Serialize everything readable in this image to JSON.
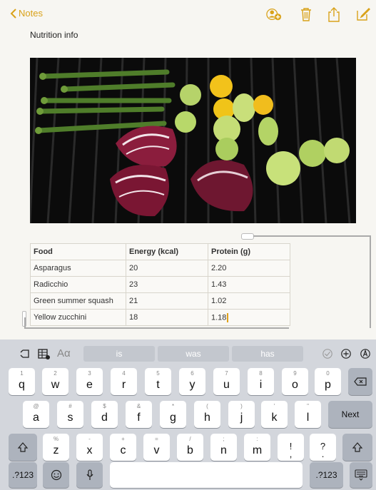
{
  "nav": {
    "back_label": "Notes"
  },
  "note": {
    "title": "Nutrition info"
  },
  "colors": {
    "accent": "#d9a21a",
    "keyboard_bg": "#d3d6dc"
  },
  "table": {
    "headers": [
      "Food",
      "Energy (kcal)",
      "Protein (g)"
    ],
    "rows": [
      [
        "Asparagus",
        "20",
        "2.20"
      ],
      [
        "Radicchio",
        "23",
        "1.43"
      ],
      [
        "Green summer squash",
        "21",
        "1.02"
      ],
      [
        "Yellow zucchini",
        "18",
        "1.18"
      ]
    ]
  },
  "suggestions": [
    "is",
    "was",
    "has"
  ],
  "keyboard": {
    "row1": [
      [
        "1",
        "q"
      ],
      [
        "2",
        "w"
      ],
      [
        "3",
        "e"
      ],
      [
        "4",
        "r"
      ],
      [
        "5",
        "t"
      ],
      [
        "6",
        "y"
      ],
      [
        "7",
        "u"
      ],
      [
        "8",
        "i"
      ],
      [
        "9",
        "o"
      ],
      [
        "0",
        "p"
      ]
    ],
    "row2": [
      [
        "@",
        "a"
      ],
      [
        "#",
        "s"
      ],
      [
        "$",
        "d"
      ],
      [
        "&",
        "f"
      ],
      [
        "*",
        "g"
      ],
      [
        "(",
        "h"
      ],
      [
        ")",
        "j"
      ],
      [
        "'",
        "k"
      ],
      [
        "\"",
        "l"
      ]
    ],
    "row3": [
      [
        "%",
        "z"
      ],
      [
        "-",
        "x"
      ],
      [
        "+",
        "c"
      ],
      [
        "=",
        "v"
      ],
      [
        "/",
        "b"
      ],
      [
        ";",
        "n"
      ],
      [
        ":",
        "m"
      ],
      [
        "",
        "!\n,"
      ],
      [
        "",
        "?\n."
      ]
    ],
    "next_label": "Next",
    "numbers_label": ".?123"
  }
}
